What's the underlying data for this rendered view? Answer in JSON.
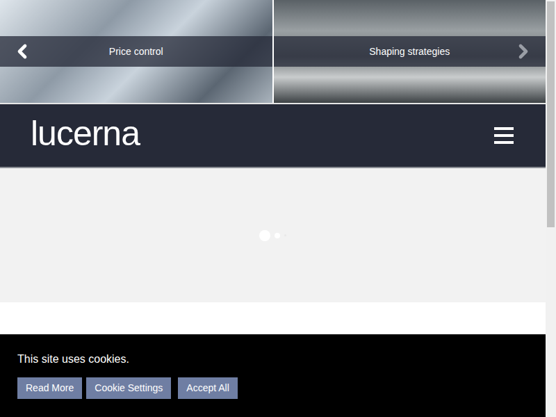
{
  "carousel": {
    "slides": [
      {
        "caption": "Price control"
      },
      {
        "caption": "Shaping strategies"
      }
    ]
  },
  "header": {
    "logo": "lucerna"
  },
  "cookie_banner": {
    "message": "This site uses cookies.",
    "buttons": [
      "Read More",
      "Cookie Settings",
      "Accept All"
    ]
  }
}
